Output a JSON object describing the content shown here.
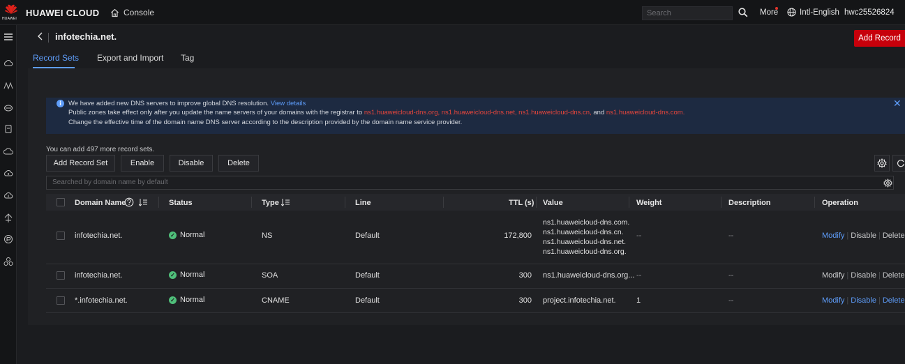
{
  "topbar": {
    "logo_word": "HUAWEI",
    "brand": "HUAWEI CLOUD",
    "console": "Console",
    "search_placeholder": "Search",
    "more": "More",
    "language": "Intl-English",
    "user": "hwc25526824"
  },
  "page": {
    "back_icon": "chevron-left-icon",
    "domain": "infotechia.net.",
    "add_record": "Add Record",
    "tabs": [
      "Record Sets",
      "Export and Import",
      "Tag"
    ],
    "active_tab": "Record Sets"
  },
  "notice": {
    "line1_text": "We have added new DNS servers to improve global DNS resolution.",
    "line1_link": "View details",
    "line2_prefix": "Public zones take effect only after you update the name servers of your domains with the registrar to",
    "line2_servers": [
      "ns1.huaweicloud-dns.org,",
      "ns1.huaweicloud-dns.net,",
      "ns1.huaweicloud-dns.cn,",
      "ns1.huaweicloud-dns.com."
    ],
    "line2_and": "and",
    "line3": "Change the effective time of the domain name DNS server according to the description provided by the domain name service provider.",
    "close": "✕"
  },
  "toolbar": {
    "quota": "You can add 497 more record sets.",
    "add_record_set": "Add Record Set",
    "enable": "Enable",
    "disable": "Disable",
    "delete": "Delete",
    "search_placeholder": "Searched by domain name by default"
  },
  "table": {
    "columns": {
      "domain": "Domain Name",
      "status": "Status",
      "type": "Type",
      "line": "Line",
      "ttl": "TTL (s)",
      "value": "Value",
      "weight": "Weight",
      "description": "Description",
      "operation": "Operation"
    },
    "rows": [
      {
        "domain": "infotechia.net.",
        "status": "Normal",
        "type": "NS",
        "line": "Default",
        "ttl": "172,800",
        "value": [
          "ns1.huaweicloud-dns.com.",
          "ns1.huaweicloud-dns.cn.",
          "ns1.huaweicloud-dns.net.",
          "ns1.huaweicloud-dns.org."
        ],
        "weight": "--",
        "description": "--",
        "ops": [
          "Modify",
          "Disable",
          "Delete"
        ]
      },
      {
        "domain": "infotechia.net.",
        "status": "Normal",
        "type": "SOA",
        "line": "Default",
        "ttl": "300",
        "value": "ns1.huaweicloud-dns.org...",
        "weight": "--",
        "description": "--",
        "ops": [
          "Modify",
          "Disable",
          "Delete"
        ]
      },
      {
        "domain": "*.infotechia.net.",
        "status": "Normal",
        "type": "CNAME",
        "line": "Default",
        "ttl": "300",
        "value": "project.infotechia.net.",
        "weight": "1",
        "description": "--",
        "ops": [
          "Modify",
          "Disable",
          "Delete"
        ]
      }
    ]
  },
  "colors": {
    "accent": "#5e9dfa",
    "brand_red": "#c7000b",
    "status_ok": "#4fbf7a",
    "notice_bg": "#1d2a41"
  }
}
